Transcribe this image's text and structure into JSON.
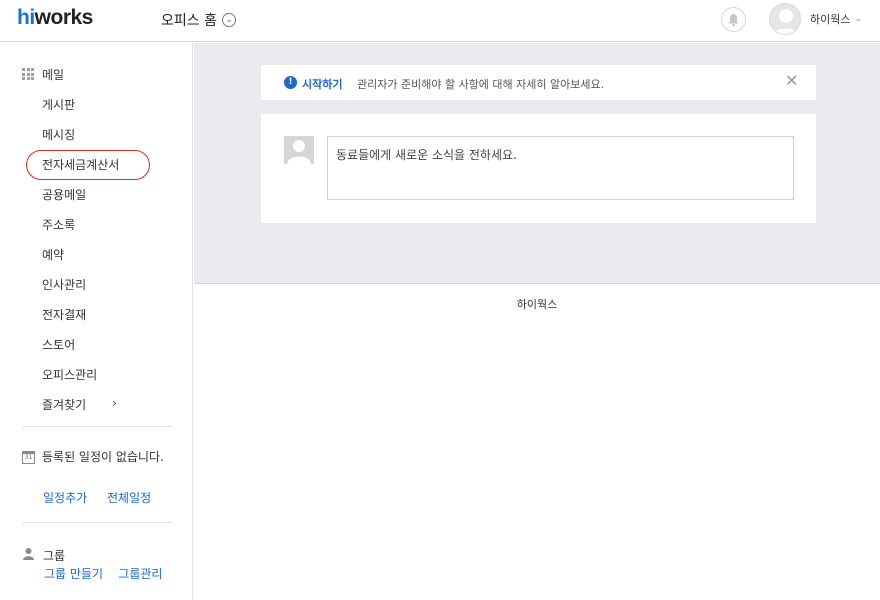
{
  "header": {
    "logo_hi": "hi",
    "logo_works": "works",
    "office_home": "오피스 홈",
    "user_name": "하이웍스"
  },
  "sidebar": {
    "menu": [
      "메일",
      "게시판",
      "메시징",
      "전자세금계산서",
      "공용메일",
      "주소록",
      "예약",
      "인사관리",
      "전자결재",
      "스토어",
      "오피스관리",
      "즐겨찾기"
    ],
    "highlighted_item": "전자세금계산서",
    "highlight_color": "#d32f2f",
    "schedule": {
      "empty_text": "등록된 일정이 없습니다.",
      "add_link": "일정추가",
      "all_link": "전체일정"
    },
    "group": {
      "title": "그룹",
      "create_link": "그룹 만들기",
      "manage_link": "그룹관리"
    }
  },
  "notice": {
    "start_label": "시작하기",
    "message": "관리자가 준비해야 할 사항에 대해 자세히 알아보세요."
  },
  "post": {
    "placeholder": "동료들에게 새로운 소식을 전하세요."
  },
  "footer": {
    "text": "하이웍스"
  },
  "colors": {
    "accent": "#1e68c8",
    "main_background": "#e9ebee"
  }
}
